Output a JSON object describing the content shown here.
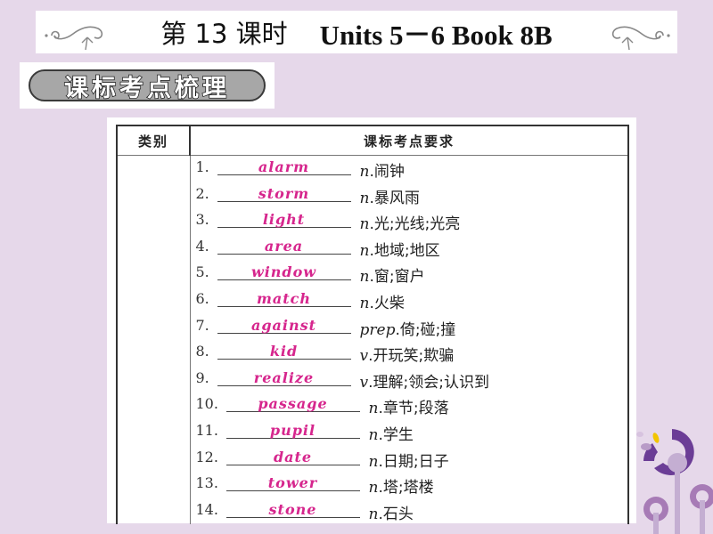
{
  "header": {
    "title_cn": "第 13 课时",
    "title_en": "Units 5－6 Book 8B"
  },
  "section": {
    "label": "课标考点梳理"
  },
  "table": {
    "columns": [
      "类别",
      "课标考点要求"
    ],
    "category": "",
    "items": [
      {
        "num": "1.",
        "answer": "alarm",
        "pos": "n",
        "meaning": ".闹钟"
      },
      {
        "num": "2.",
        "answer": "storm",
        "pos": "n",
        "meaning": ".暴风雨"
      },
      {
        "num": "3.",
        "answer": "light",
        "pos": "n",
        "meaning": ".光;光线;光亮"
      },
      {
        "num": "4.",
        "answer": "area",
        "pos": "n",
        "meaning": ".地域;地区"
      },
      {
        "num": "5.",
        "answer": "window",
        "pos": "n",
        "meaning": ".窗;窗户"
      },
      {
        "num": "6.",
        "answer": "match",
        "pos": "n",
        "meaning": ".火柴"
      },
      {
        "num": "7.",
        "answer": "against",
        "pos": "prep",
        "meaning": ".倚;碰;撞"
      },
      {
        "num": "8.",
        "answer": "kid",
        "pos": "v",
        "meaning": ".开玩笑;欺骗"
      },
      {
        "num": "9.",
        "answer": "realize",
        "pos": "v",
        "meaning": ".理解;领会;认识到"
      },
      {
        "num": "10.",
        "answer": "passage",
        "pos": "n",
        "meaning": ".章节;段落"
      },
      {
        "num": "11.",
        "answer": "pupil",
        "pos": "n",
        "meaning": ".学生"
      },
      {
        "num": "12.",
        "answer": "date",
        "pos": "n",
        "meaning": ".日期;日子"
      },
      {
        "num": "13.",
        "answer": "tower",
        "pos": "n",
        "meaning": ".塔;塔楼"
      },
      {
        "num": "14.",
        "answer": "stone",
        "pos": "n",
        "meaning": ".石头"
      }
    ]
  },
  "colors": {
    "background": "#e6d8ea",
    "answer": "#d6268d",
    "deco_purple": "#6b3d96",
    "deco_lilac": "#b89bc7",
    "deco_yellow": "#f2c500"
  }
}
